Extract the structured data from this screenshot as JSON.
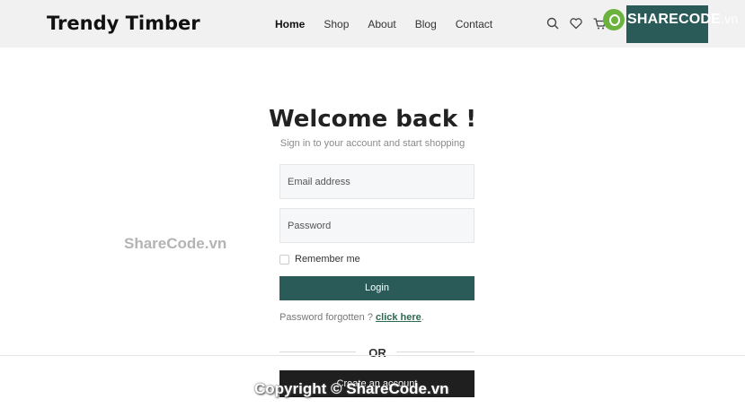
{
  "header": {
    "brand": "Trendy Timber",
    "nav": [
      {
        "label": "Home",
        "active": true
      },
      {
        "label": "Shop",
        "active": false
      },
      {
        "label": "About",
        "active": false
      },
      {
        "label": "Blog",
        "active": false
      },
      {
        "label": "Contact",
        "active": false
      }
    ],
    "icons": [
      "search-icon",
      "heart-icon",
      "cart-icon"
    ],
    "logo_text": "SHARECODE",
    "logo_suffix": ".vn"
  },
  "login": {
    "title": "Welcome back !",
    "subtitle": "Sign in to your account and start shopping",
    "email_placeholder": "Email address",
    "password_placeholder": "Password",
    "remember_label": "Remember me",
    "login_label": "Login",
    "forgot_text": "Password forgotten ?",
    "forgot_link": "click here",
    "forgot_period": ".",
    "or_text": "OR",
    "create_label": "Create an account"
  },
  "watermarks": {
    "middle": "ShareCode.vn",
    "bottom": "Copyright © ShareCode.vn"
  },
  "colors": {
    "accent": "#2b5b58",
    "header_bg": "#f1f1f1",
    "dark_button": "#1f1f1f"
  }
}
